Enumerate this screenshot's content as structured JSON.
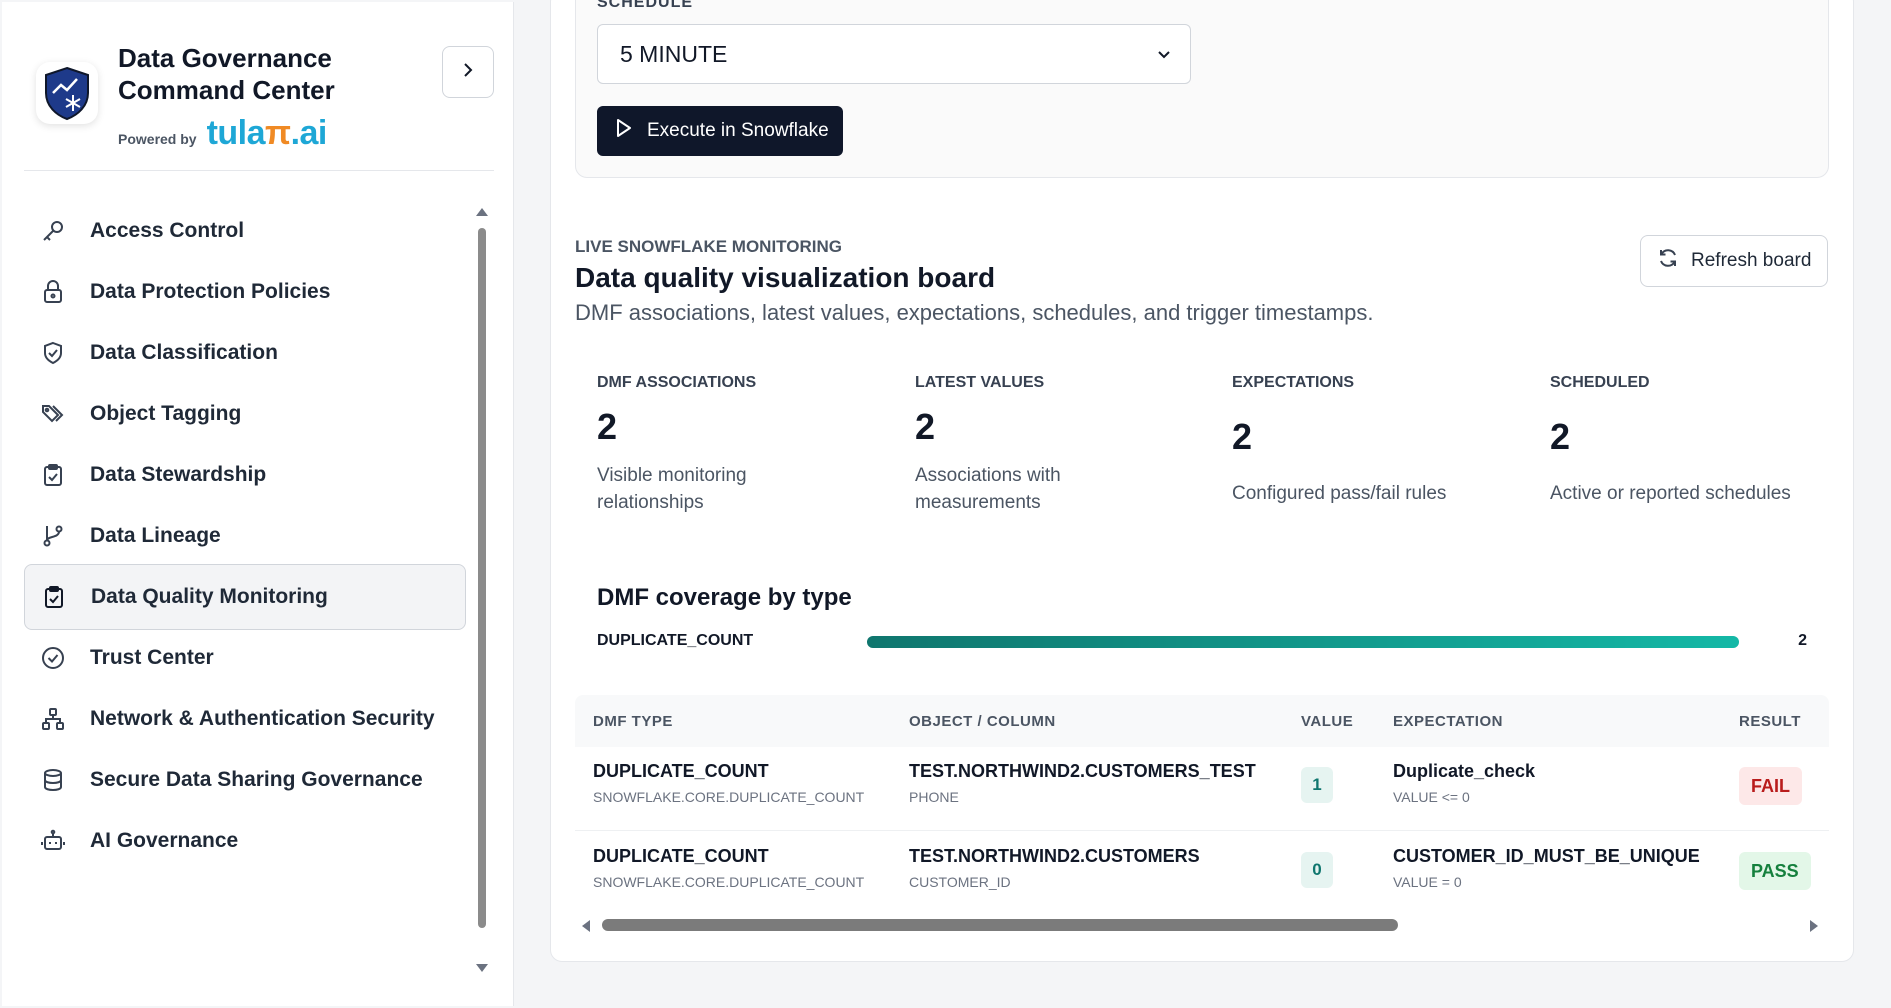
{
  "brand": {
    "title": "Data Governance Command Center",
    "powered_by_label": "Powered by",
    "powered_by_logo_text": "tula",
    "powered_by_logo_pi": "π",
    "powered_by_logo_suffix": ".ai",
    "logo_icon": "shield-chart-snowflake-icon"
  },
  "sidebar": {
    "collapse_icon": "chevron-right-icon",
    "items": [
      {
        "label": "Access Control",
        "icon": "key-icon"
      },
      {
        "label": "Data Protection Policies",
        "icon": "lock-icon"
      },
      {
        "label": "Data Classification",
        "icon": "shield-check-icon"
      },
      {
        "label": "Object Tagging",
        "icon": "tags-icon"
      },
      {
        "label": "Data Stewardship",
        "icon": "clipboard-check-icon"
      },
      {
        "label": "Data Lineage",
        "icon": "git-branch-icon"
      },
      {
        "label": "Data Quality Monitoring",
        "icon": "clipboard-check-icon",
        "active": true
      },
      {
        "label": "Trust Center",
        "icon": "check-circle-icon"
      },
      {
        "label": "Network & Authentication Security",
        "icon": "network-icon"
      },
      {
        "label": "Secure Data Sharing Governance",
        "icon": "database-icon"
      },
      {
        "label": "AI Governance",
        "icon": "bot-icon"
      }
    ]
  },
  "schedule": {
    "label": "SCHEDULE",
    "selected": "5 MINUTE",
    "execute_label": "Execute in Snowflake"
  },
  "board": {
    "eyebrow": "LIVE SNOWFLAKE MONITORING",
    "title": "Data quality visualization board",
    "subtitle": "DMF associations, latest values, expectations, schedules, and trigger timestamps.",
    "refresh_label": "Refresh board"
  },
  "metrics": [
    {
      "label": "DMF ASSOCIATIONS",
      "value": "2",
      "desc": "Visible monitoring relationships"
    },
    {
      "label": "LATEST VALUES",
      "value": "2",
      "desc": "Associations with measurements"
    },
    {
      "label": "EXPECTATIONS",
      "value": "2",
      "desc": "Configured pass/fail rules"
    },
    {
      "label": "SCHEDULED",
      "value": "2",
      "desc": "Active or reported schedules"
    }
  ],
  "coverage": {
    "title": "DMF coverage by type",
    "rows": [
      {
        "label": "DUPLICATE_COUNT",
        "count": "2",
        "fraction": 1.0
      }
    ]
  },
  "table": {
    "headers": {
      "dmf_type": "DMF TYPE",
      "object_column": "OBJECT / COLUMN",
      "value": "VALUE",
      "expectation": "EXPECTATION",
      "result": "RESULT"
    },
    "rows": [
      {
        "dmf_type": "DUPLICATE_COUNT",
        "dmf_full": "SNOWFLAKE.CORE.DUPLICATE_COUNT",
        "object": "TEST.NORTHWIND2.CUSTOMERS_TEST",
        "column": "PHONE",
        "value": "1",
        "expectation": "Duplicate_check",
        "expectation_rule": "VALUE <= 0",
        "result": "FAIL"
      },
      {
        "dmf_type": "DUPLICATE_COUNT",
        "dmf_full": "SNOWFLAKE.CORE.DUPLICATE_COUNT",
        "object": "TEST.NORTHWIND2.CUSTOMERS",
        "column": "CUSTOMER_ID",
        "value": "0",
        "expectation": "CUSTOMER_ID_MUST_BE_UNIQUE",
        "expectation_rule": "VALUE = 0",
        "result": "PASS"
      }
    ]
  },
  "colors": {
    "accent_dark": "#0f172a",
    "teal": "#0f766e",
    "fail": "#b91c1c",
    "pass": "#15803d"
  }
}
